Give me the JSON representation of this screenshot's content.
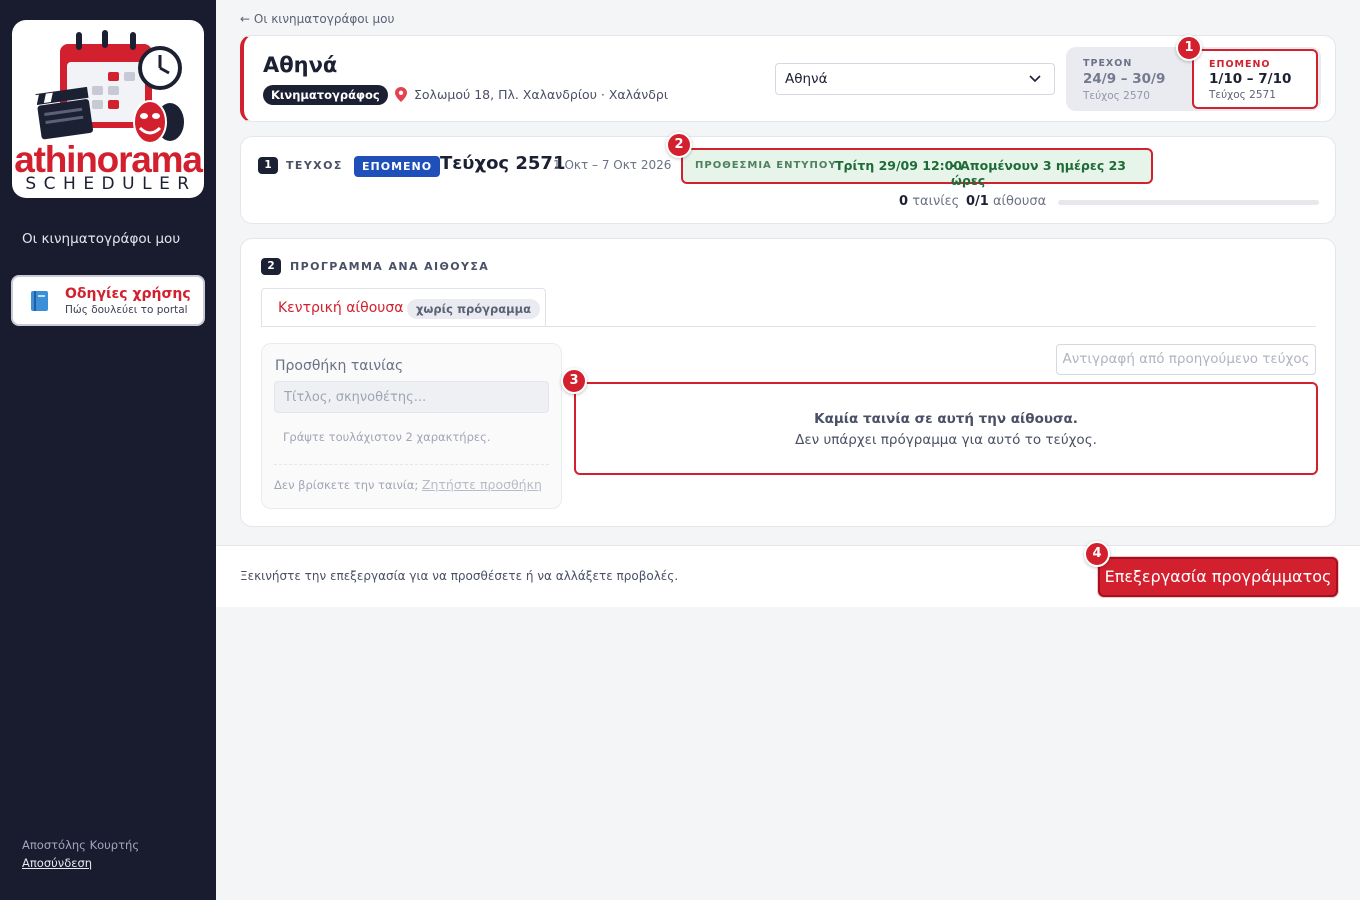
{
  "sidebar": {
    "logo_word": "athinorama",
    "logo_sub": "SCHEDULER",
    "nav_my_cinemas": "Οι κινηματογράφοι μου",
    "help_title": "Οδηγίες χρήσης",
    "help_subtitle": "Πώς δουλεύει το portal",
    "user_name": "Αποστόλης Κουρτής",
    "logout": "Αποσύνδεση"
  },
  "header": {
    "back_link": "← Οι κινηματογράφοι μου"
  },
  "cinema": {
    "name": "Αθηνά",
    "type": "Κινηματογράφος",
    "address": "Σολωμού 18, Πλ. Χαλανδρίου · Χαλάνδρι",
    "select_value": "Αθηνά"
  },
  "issue_toggle": {
    "current_label": "ΤΡΕΧΟΝ",
    "current_range": "24/9 – 30/9",
    "current_issue": "Τεύχος 2570",
    "next_label": "ΕΠΟΜΕΝΟ",
    "next_range": "1/10 – 7/10",
    "next_issue": "Τεύχος 2571"
  },
  "issue_section": {
    "step": "1",
    "label": "ΤΕΥΧΟΣ",
    "badge": "ΕΠΟΜΕΝΟ",
    "title": "Τεύχος 2571",
    "dates": "1 Οκτ – 7 Οκτ 2026",
    "deadline_label": "ΠΡΟΘΕΣΜΙΑ ΕΝΤΥΠΟΥ",
    "deadline_date": "Τρίτη 29/09 12:00",
    "deadline_remaining": "· Απομένουν 3 ημέρες 23 ώρες",
    "films_count": "0",
    "films_label": "ταινίες",
    "rooms_count": "0/1",
    "rooms_label": "αίθουσα",
    "progress": 0
  },
  "program_section": {
    "step": "2",
    "label": "ΠΡΟΓΡΑΜΜΑ ΑΝΑ ΑΙΘΟΥΣΑ",
    "tab_label": "Κεντρική αίθουσα",
    "tab_badge": "χωρίς πρόγραμμα",
    "add_title": "Προσθήκη ταινίας",
    "add_placeholder": "Τίτλος, σκηνοθέτης...",
    "add_hint": "Γράψτε τουλάχιστον 2 χαρακτήρες.",
    "add_missing": "Δεν βρίσκετε την ταινία;",
    "add_request": "Ζητήστε προσθήκη",
    "copy_button": "Αντιγραφή από προηγούμενο τεύχος",
    "empty_title": "Καμία ταινία σε αυτή την αίθουσα.",
    "empty_subtitle": "Δεν υπάρχει πρόγραμμα για αυτό το τεύχος."
  },
  "footer": {
    "text": "Ξεκινήστε την επεξεργασία για να προσθέσετε ή να αλλάξετε προβολές.",
    "edit_button": "Επεξεργασία προγράμματος"
  },
  "markers": [
    "1",
    "2",
    "3",
    "4"
  ],
  "colors": {
    "accent": "#d3202e",
    "sidebar_bg": "#191c2e",
    "badge_blue": "#1f4fb8",
    "deadline_bg": "#e6f4ea",
    "deadline_text": "#1e6b37"
  }
}
